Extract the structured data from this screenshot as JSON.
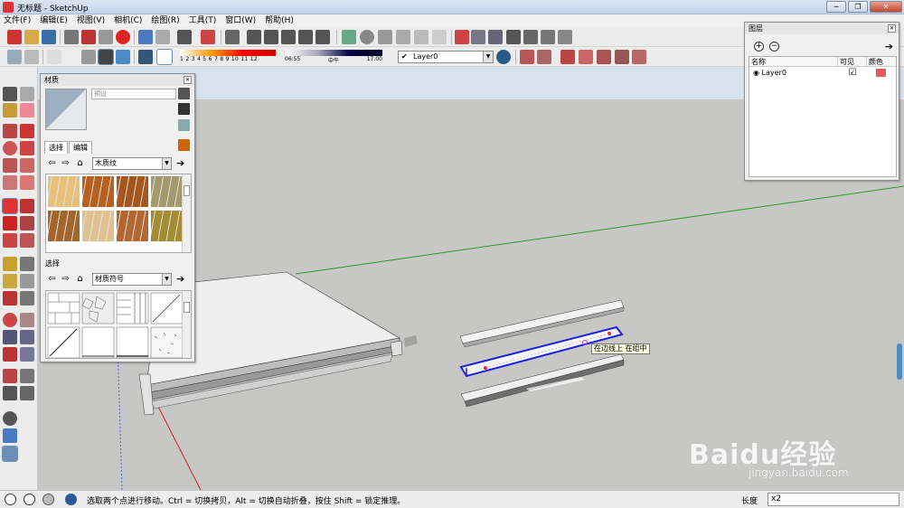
{
  "window": {
    "title": "无标题 - SketchUp",
    "min": "─",
    "max": "❐",
    "close": "✕"
  },
  "menu": [
    "文件(F)",
    "编辑(E)",
    "视图(V)",
    "相机(C)",
    "绘图(R)",
    "工具(T)",
    "窗口(W)",
    "帮助(H)"
  ],
  "toolbar": {
    "color_scale_nums": "1 2 3 4 5 6 7 8 9 10 11 12",
    "time_start": "06:55",
    "time_mid": "中午",
    "time_end": "17:00",
    "layer_selected": "Layer0",
    "check": "✔"
  },
  "materials": {
    "title": "材质",
    "preset_placeholder": "预设",
    "tab_select": "选择",
    "tab_edit": "编辑",
    "library_1": "木质纹",
    "select_label": "选择",
    "library_2": "材质符号",
    "colors": {
      "wood": [
        "#e8c07a",
        "#b9601e",
        "#a9561d",
        "#a59a6c",
        "#a3652a",
        "#dfc28f",
        "#b5652f",
        "#a48c32"
      ]
    }
  },
  "layers": {
    "title": "图层",
    "col_name": "名称",
    "col_visible": "可见",
    "col_color": "颜色",
    "rows": [
      {
        "name": "Layer0",
        "visible": "☑",
        "color": "#e85a5a"
      }
    ]
  },
  "viewport": {
    "tooltip": "在边线上 在组中"
  },
  "status": {
    "text": "选取两个点进行移动。Ctrl = 切换拷贝，Alt = 切换自动折叠，按住 Shift = 锁定推理。",
    "measure_label": "长度",
    "measure_value": "x2"
  },
  "watermark": {
    "brand": "Baidu经验",
    "url": "jingyan.baidu.com"
  }
}
